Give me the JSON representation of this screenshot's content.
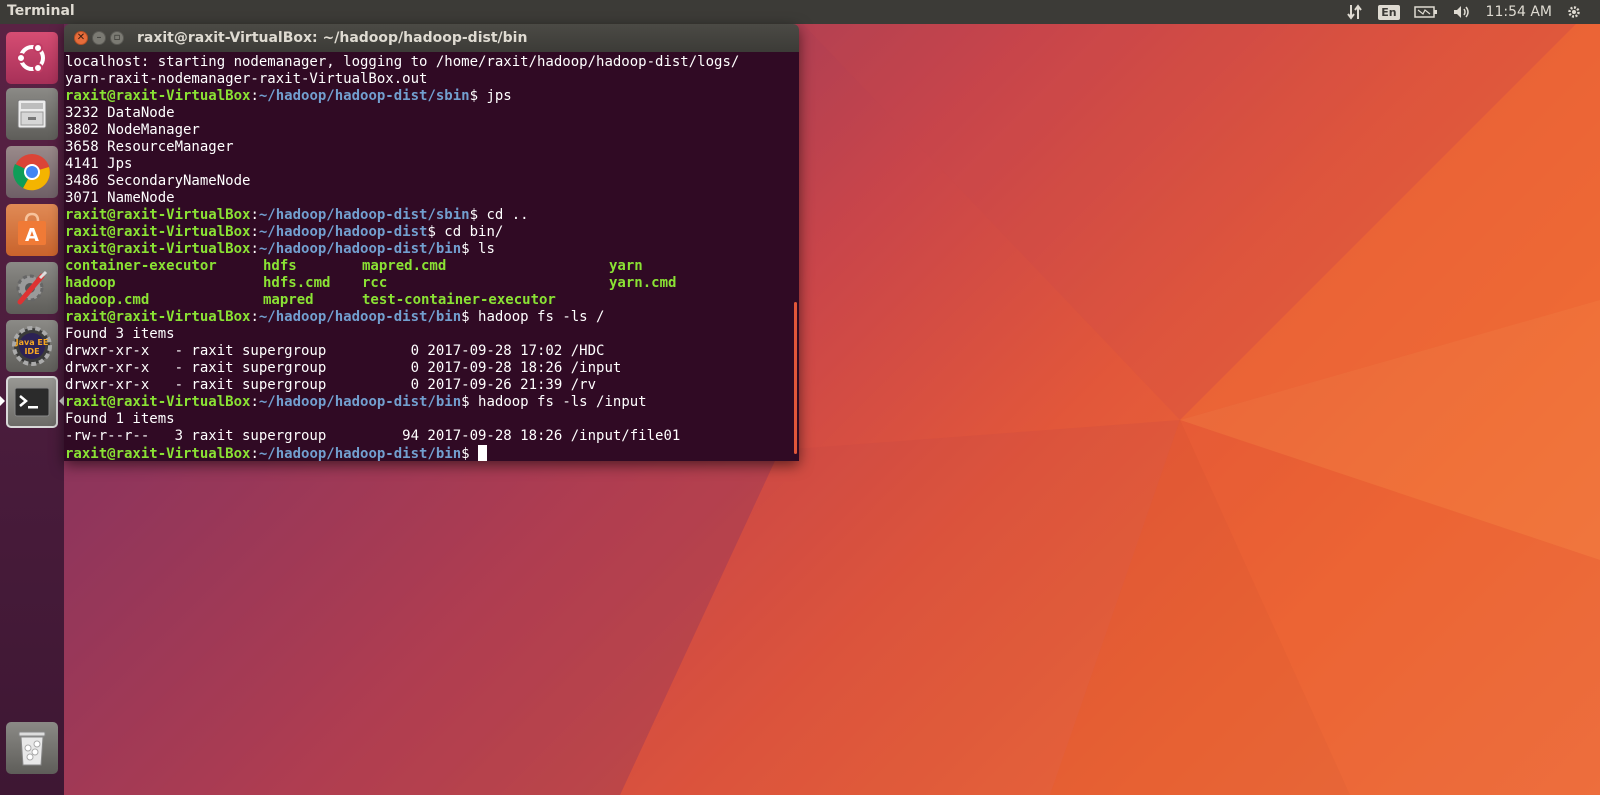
{
  "top_panel": {
    "app_name": "Terminal",
    "keyboard_layout": "En",
    "clock": "11:54 AM",
    "icons": [
      "network-arrows-icon",
      "keyboard-layout-icon",
      "battery-icon",
      "volume-icon"
    ]
  },
  "launcher": {
    "items": [
      {
        "name": "ubuntu-dash-icon",
        "label": "Search your computer"
      },
      {
        "name": "files-icon",
        "label": "Files"
      },
      {
        "name": "chrome-icon",
        "label": "Google Chrome"
      },
      {
        "name": "software-center-icon",
        "label": "Ubuntu Software"
      },
      {
        "name": "system-settings-icon",
        "label": "System Settings"
      },
      {
        "name": "eclipse-java-ee-icon",
        "label": "Java EE IDE",
        "text1": "Java EE",
        "text2": "IDE"
      },
      {
        "name": "terminal-icon",
        "label": "Terminal"
      },
      {
        "name": "trash-icon",
        "label": "Trash"
      }
    ]
  },
  "terminal": {
    "title": "raxit@raxit-VirtualBox: ~/hadoop/hadoop-dist/bin",
    "prompt_user": "raxit@raxit-VirtualBox",
    "lines": {
      "l1": "localhost: starting nodemanager, logging to /home/raxit/hadoop/hadoop-dist/logs/",
      "l2": "yarn-raxit-nodemanager-raxit-VirtualBox.out",
      "p3_path": "~/hadoop/hadoop-dist/sbin",
      "p3_cmd": "$ jps",
      "l4": "3232 DataNode",
      "l5": "3802 NodeManager",
      "l6": "3658 ResourceManager",
      "l7": "4141 Jps",
      "l8": "3486 SecondaryNameNode",
      "l9": "3071 NameNode",
      "p10_path": "~/hadoop/hadoop-dist/sbin",
      "p10_cmd": "$ cd ..",
      "p11_path": "~/hadoop/hadoop-dist",
      "p11_cmd": "$ cd bin/",
      "p12_path": "~/hadoop/hadoop-dist/bin",
      "p12_cmd": "$ ls",
      "ls_row1": [
        "container-executor",
        "hdfs",
        "mapred.cmd",
        "yarn"
      ],
      "ls_row2": [
        "hadoop",
        "hdfs.cmd",
        "rcc",
        "yarn.cmd"
      ],
      "ls_row3": [
        "hadoop.cmd",
        "mapred",
        "test-container-executor",
        ""
      ],
      "p16_path": "~/hadoop/hadoop-dist/bin",
      "p16_cmd": "$ hadoop fs -ls /",
      "l17": "Found 3 items",
      "l18": "drwxr-xr-x   - raxit supergroup          0 2017-09-28 17:02 /HDC",
      "l19": "drwxr-xr-x   - raxit supergroup          0 2017-09-28 18:26 /input",
      "l20": "drwxr-xr-x   - raxit supergroup          0 2017-09-26 21:39 /rv",
      "p21_path": "~/hadoop/hadoop-dist/bin",
      "p21_cmd": "$ hadoop fs -ls /input",
      "l22": "Found 1 items",
      "l23": "-rw-r--r--   3 raxit supergroup         94 2017-09-28 18:26 /input/file01",
      "p24_path": "~/hadoop/hadoop-dist/bin",
      "p24_cmd": "$ "
    }
  },
  "colors": {
    "terminal_bg": "#300a24",
    "prompt_green": "#8ae234",
    "path_blue": "#729fcf",
    "panel": "#3c3b37",
    "accent_orange": "#e2573a"
  }
}
